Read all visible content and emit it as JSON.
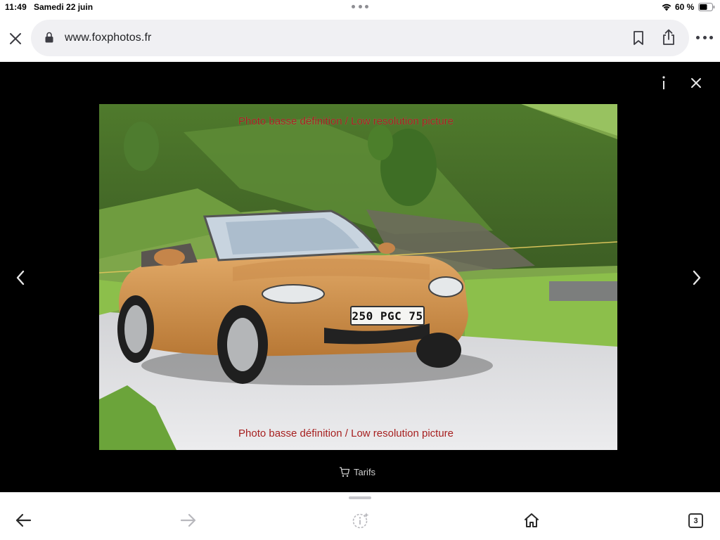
{
  "status_bar": {
    "time": "11:49",
    "date": "Samedi 22 juin",
    "battery": "60 %"
  },
  "toolbar": {
    "url": "www.foxphotos.fr",
    "icons": [
      "close-icon",
      "lock-icon",
      "bookmark-icon",
      "share-icon",
      "more-icon"
    ]
  },
  "viewer": {
    "watermark_top": "Photo basse définition / Low resolution picture",
    "watermark_bottom": "Photo basse définition / Low resolution picture",
    "plate": "250 PGC 75",
    "tarifs_label": "Tarifs",
    "icons": [
      "info-icon",
      "close-icon",
      "chevron-left-icon",
      "chevron-right-icon",
      "cart-icon"
    ]
  },
  "bottom_bar": {
    "tab_count": "3",
    "icons": [
      "back-arrow-icon",
      "forward-arrow-icon",
      "insight-icon",
      "home-icon",
      "tabs-icon"
    ]
  },
  "colors": {
    "viewer_bg": "#000000",
    "car": "#c98a4b",
    "watermark": "#a51e1e"
  }
}
